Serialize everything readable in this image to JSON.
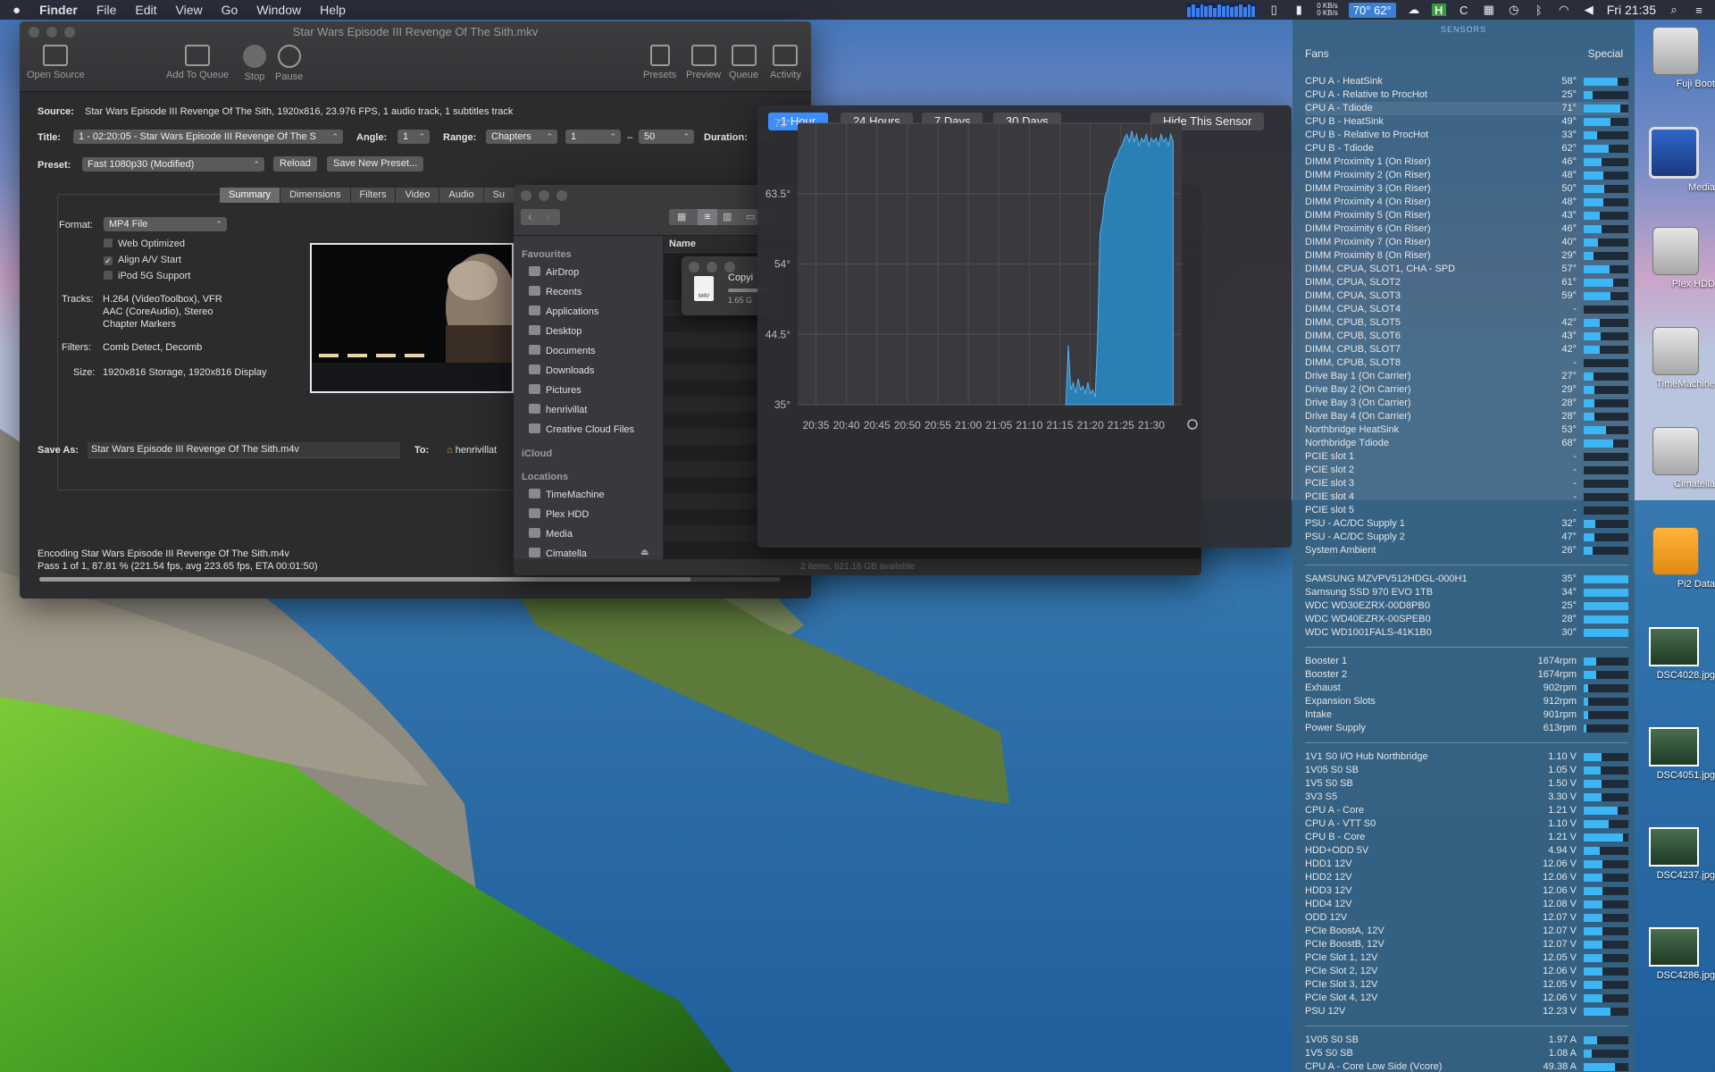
{
  "menubar": {
    "apple": "",
    "items": [
      "Finder",
      "File",
      "Edit",
      "View",
      "Go",
      "Window",
      "Help"
    ],
    "net_up": "0 KB/s",
    "net_down": "0 KB/s",
    "temps": "70° 62°",
    "clock": "Fri 21:35"
  },
  "handbrake": {
    "title": "Star Wars Episode III Revenge Of The Sith.mkv",
    "toolbar": {
      "open_source": "Open Source",
      "add_to_queue": "Add To Queue",
      "stop": "Stop",
      "pause": "Pause",
      "presets": "Presets",
      "preview": "Preview",
      "queue": "Queue",
      "activity": "Activity"
    },
    "source_label": "Source:",
    "source_value": "Star Wars Episode III Revenge Of The Sith, 1920x816, 23.976 FPS, 1 audio track, 1 subtitles track",
    "title_label": "Title:",
    "title_value": "1 - 02:20:05 - Star Wars Episode III Revenge Of The S",
    "angle_label": "Angle:",
    "angle_value": "1",
    "range_label": "Range:",
    "range_type": "Chapters",
    "range_from": "1",
    "range_dash": "–",
    "range_to": "50",
    "duration_label": "Duration:",
    "duration_value": "02",
    "preset_label": "Preset:",
    "preset_value": "Fast 1080p30 (Modified)",
    "reload": "Reload",
    "save_new_preset": "Save New Preset...",
    "tabs": [
      "Summary",
      "Dimensions",
      "Filters",
      "Video",
      "Audio",
      "Su"
    ],
    "format_label": "Format:",
    "format_value": "MP4 File",
    "web_optimized": "Web Optimized",
    "align_av": "Align A/V Start",
    "ipod": "iPod 5G Support",
    "tracks_label": "Tracks:",
    "tracks_lines": [
      "H.264 (VideoToolbox), VFR",
      "AAC (CoreAudio), Stereo",
      "Chapter Markers"
    ],
    "filters_label": "Filters:",
    "filters_value": "Comb Detect, Decomb",
    "size_label": "Size:",
    "size_value": "1920x816 Storage, 1920x816 Display",
    "save_as_label": "Save As:",
    "save_as_value": "Star Wars Episode III Revenge Of The Sith.m4v",
    "to_label": "To:",
    "to_value": "henrivillat",
    "encoding_line": "Encoding Star Wars Episode III Revenge Of The Sith.m4v",
    "pass_line": "Pass 1 of 1, 87.81 % (221.54 fps, avg 223.65 fps, ETA 00:01:50)",
    "progress": 0.8781
  },
  "finder": {
    "favourites_header": "Favourites",
    "favourites": [
      "AirDrop",
      "Recents",
      "Applications",
      "Desktop",
      "Documents",
      "Downloads",
      "Pictures",
      "henrivillat",
      "Creative Cloud Files"
    ],
    "icloud_header": "iCloud",
    "locations_header": "Locations",
    "locations": [
      "TimeMachine",
      "Plex HDD",
      "Media",
      "Cimatella"
    ],
    "column_name": "Name",
    "status": "2 items, 621.16 GB available",
    "copy_title": "Copyi",
    "copy_size": "1.65 G",
    "file_badge": "M4V"
  },
  "history": {
    "tabs": [
      "1 Hour",
      "24 Hours",
      "7 Days",
      "30 Days"
    ],
    "hide": "Hide This Sensor"
  },
  "chart_data": {
    "type": "area",
    "title": "",
    "xlabel": "",
    "ylabel": "",
    "ylim": [
      35,
      73
    ],
    "y_ticks": [
      "73°",
      "63.5°",
      "54°",
      "44.5°",
      "35°"
    ],
    "x_ticks": [
      "20:35",
      "20:40",
      "20:45",
      "20:50",
      "20:55",
      "21:00",
      "21:05",
      "21:10",
      "21:15",
      "21:20",
      "21:25",
      "21:30"
    ],
    "x_range": [
      "20:32",
      "21:35"
    ],
    "points": [
      [
        "21:16.0",
        35
      ],
      [
        "21:16.4",
        43
      ],
      [
        "21:16.8",
        37
      ],
      [
        "21:17.2",
        38
      ],
      [
        "21:17.6",
        36.5
      ],
      [
        "21:18.0",
        38.5
      ],
      [
        "21:18.4",
        37
      ],
      [
        "21:18.8",
        37.5
      ],
      [
        "21:19.2",
        36.5
      ],
      [
        "21:19.6",
        38
      ],
      [
        "21:20.0",
        36.5
      ],
      [
        "21:20.4",
        37
      ],
      [
        "21:20.8",
        36
      ],
      [
        "21:21.2",
        44
      ],
      [
        "21:21.6",
        58
      ],
      [
        "21:22.0",
        60
      ],
      [
        "21:22.4",
        63
      ],
      [
        "21:22.8",
        64
      ],
      [
        "21:23.2",
        66
      ],
      [
        "21:23.6",
        67
      ],
      [
        "21:24.0",
        68
      ],
      [
        "21:24.4",
        68.5
      ],
      [
        "21:24.8",
        69.5
      ],
      [
        "21:25.2",
        70
      ],
      [
        "21:25.6",
        71
      ],
      [
        "21:26.0",
        71.5
      ],
      [
        "21:26.4",
        70.5
      ],
      [
        "21:26.8",
        72
      ],
      [
        "21:27.2",
        70.5
      ],
      [
        "21:27.6",
        71.5
      ],
      [
        "21:28.0",
        70
      ],
      [
        "21:28.4",
        71
      ],
      [
        "21:28.8",
        70.5
      ],
      [
        "21:29.2",
        71.5
      ],
      [
        "21:29.6",
        70
      ],
      [
        "21:30.0",
        71
      ],
      [
        "21:30.4",
        70.5
      ],
      [
        "21:30.8",
        71
      ],
      [
        "21:31.2",
        70
      ],
      [
        "21:31.6",
        71.5
      ],
      [
        "21:32.0",
        70.5
      ],
      [
        "21:32.4",
        71
      ],
      [
        "21:32.8",
        70
      ],
      [
        "21:33.2",
        71.5
      ],
      [
        "21:33.6",
        70.5
      ]
    ],
    "color": "#2a7fb5",
    "grid": true
  },
  "sensors": {
    "header": "SENSORS",
    "fans_label": "Fans",
    "special_label": "Special",
    "temperatures": [
      {
        "name": "CPU A - HeatSink",
        "value": "58°",
        "level": 0.76
      },
      {
        "name": "CPU A - Relative to ProcHot",
        "value": "25°",
        "level": 0.2
      },
      {
        "name": "CPU A - Tdiode",
        "value": "71°",
        "level": 0.82,
        "hl": true
      },
      {
        "name": "CPU B - HeatSink",
        "value": "49°",
        "level": 0.6
      },
      {
        "name": "CPU B - Relative to ProcHot",
        "value": "33°",
        "level": 0.3
      },
      {
        "name": "CPU B - Tdiode",
        "value": "62°",
        "level": 0.55
      },
      {
        "name": "DIMM Proximity 1 (On Riser)",
        "value": "46°",
        "level": 0.4
      },
      {
        "name": "DIMM Proximity 2 (On Riser)",
        "value": "48°",
        "level": 0.44
      },
      {
        "name": "DIMM Proximity 3 (On Riser)",
        "value": "50°",
        "level": 0.46
      },
      {
        "name": "DIMM Proximity 4 (On Riser)",
        "value": "48°",
        "level": 0.44
      },
      {
        "name": "DIMM Proximity 5 (On Riser)",
        "value": "43°",
        "level": 0.36
      },
      {
        "name": "DIMM Proximity 6 (On Riser)",
        "value": "46°",
        "level": 0.4
      },
      {
        "name": "DIMM Proximity 7 (On Riser)",
        "value": "40°",
        "level": 0.32
      },
      {
        "name": "DIMM Proximity 8 (On Riser)",
        "value": "29°",
        "level": 0.22
      },
      {
        "name": "DIMM, CPUA, SLOT1, CHA - SPD",
        "value": "57°",
        "level": 0.58
      },
      {
        "name": "DIMM, CPUA, SLOT2",
        "value": "61°",
        "level": 0.66
      },
      {
        "name": "DIMM, CPUA, SLOT3",
        "value": "59°",
        "level": 0.6
      },
      {
        "name": "DIMM, CPUA, SLOT4",
        "value": "-",
        "level": 0
      },
      {
        "name": "DIMM, CPUB, SLOT5",
        "value": "42°",
        "level": 0.36
      },
      {
        "name": "DIMM, CPUB, SLOT6",
        "value": "43°",
        "level": 0.37
      },
      {
        "name": "DIMM, CPUB, SLOT7",
        "value": "42°",
        "level": 0.36
      },
      {
        "name": "DIMM, CPUB, SLOT8",
        "value": "-",
        "level": 0
      },
      {
        "name": "Drive Bay 1 (On Carrier)",
        "value": "27°",
        "level": 0.22
      },
      {
        "name": "Drive Bay 2 (On Carrier)",
        "value": "29°",
        "level": 0.24
      },
      {
        "name": "Drive Bay 3 (On Carrier)",
        "value": "28°",
        "level": 0.23
      },
      {
        "name": "Drive Bay 4 (On Carrier)",
        "value": "28°",
        "level": 0.23
      },
      {
        "name": "Northbridge HeatSink",
        "value": "53°",
        "level": 0.5
      },
      {
        "name": "Northbridge Tdiode",
        "value": "68°",
        "level": 0.66
      },
      {
        "name": "PCIE slot 1",
        "value": "-",
        "level": 0
      },
      {
        "name": "PCIE slot 2",
        "value": "-",
        "level": 0
      },
      {
        "name": "PCIE slot 3",
        "value": "-",
        "level": 0
      },
      {
        "name": "PCIE slot 4",
        "value": "-",
        "level": 0
      },
      {
        "name": "PCIE slot 5",
        "value": "-",
        "level": 0
      },
      {
        "name": "PSU - AC/DC Supply 1",
        "value": "32°",
        "level": 0.26
      },
      {
        "name": "PSU - AC/DC Supply 2",
        "value": "47°",
        "level": 0.24
      },
      {
        "name": "System Ambient",
        "value": "26°",
        "level": 0.2
      }
    ],
    "drives": [
      {
        "name": "SAMSUNG MZVPV512HDGL-000H1",
        "value": "35°",
        "level": 1
      },
      {
        "name": "Samsung SSD 970 EVO 1TB",
        "value": "34°",
        "level": 1
      },
      {
        "name": "WDC WD30EZRX-00D8PB0",
        "value": "25°",
        "level": 1
      },
      {
        "name": "WDC WD40EZRX-00SPEB0",
        "value": "28°",
        "level": 1
      },
      {
        "name": "WDC WD1001FALS-41K1B0",
        "value": "30°",
        "level": 1
      }
    ],
    "fans": [
      {
        "name": "Booster 1",
        "value": "1674rpm",
        "level": 0.28
      },
      {
        "name": "Booster 2",
        "value": "1674rpm",
        "level": 0.28
      },
      {
        "name": "Exhaust",
        "value": "902rpm",
        "level": 0.1
      },
      {
        "name": "Expansion Slots",
        "value": "912rpm",
        "level": 0.1
      },
      {
        "name": "Intake",
        "value": "901rpm",
        "level": 0.1
      },
      {
        "name": "Power Supply",
        "value": "613rpm",
        "level": 0.06
      }
    ],
    "voltages": [
      {
        "name": "1V1 S0 I/O Hub Northbridge",
        "value": "1.10 V",
        "level": 0.4
      },
      {
        "name": "1V05 S0 SB",
        "value": "1.05 V",
        "level": 0.38
      },
      {
        "name": "1V5 S0 SB",
        "value": "1.50 V",
        "level": 0.4
      },
      {
        "name": "3V3 S5",
        "value": "3.30 V",
        "level": 0.4
      },
      {
        "name": "CPU A - Core",
        "value": "1.21 V",
        "level": 0.75
      },
      {
        "name": "CPU A - VTT S0",
        "value": "1.10 V",
        "level": 0.55
      },
      {
        "name": "CPU B - Core",
        "value": "1.21 V",
        "level": 0.88
      },
      {
        "name": "HDD+ODD 5V",
        "value": "4.94 V",
        "level": 0.35
      },
      {
        "name": "HDD1 12V",
        "value": "12.06 V",
        "level": 0.42
      },
      {
        "name": "HDD2 12V",
        "value": "12.06 V",
        "level": 0.42
      },
      {
        "name": "HDD3 12V",
        "value": "12.06 V",
        "level": 0.42
      },
      {
        "name": "HDD4 12V",
        "value": "12.08 V",
        "level": 0.42
      },
      {
        "name": "ODD 12V",
        "value": "12.07 V",
        "level": 0.42
      },
      {
        "name": "PCIe BoostA, 12V",
        "value": "12.07 V",
        "level": 0.42
      },
      {
        "name": "PCIe BoostB, 12V",
        "value": "12.07 V",
        "level": 0.42
      },
      {
        "name": "PCIe Slot 1, 12V",
        "value": "12.05 V",
        "level": 0.42
      },
      {
        "name": "PCIe Slot 2, 12V",
        "value": "12.06 V",
        "level": 0.42
      },
      {
        "name": "PCIe Slot 3, 12V",
        "value": "12.05 V",
        "level": 0.42
      },
      {
        "name": "PCIe Slot 4, 12V",
        "value": "12.06 V",
        "level": 0.42
      },
      {
        "name": "PSU 12V",
        "value": "12.23 V",
        "level": 0.6
      }
    ],
    "currents": [
      {
        "name": "1V05 S0 SB",
        "value": "1.97 A",
        "level": 0.3
      },
      {
        "name": "1V5 S0 SB",
        "value": "1.08 A",
        "level": 0.18
      },
      {
        "name": "CPU A - Core Low Side (Vcore)",
        "value": "49.38 A",
        "level": 0.7
      }
    ]
  },
  "desktop_icons": [
    {
      "label": "Fuji Boot",
      "kind": "drive"
    },
    {
      "label": "Media",
      "kind": "screen"
    },
    {
      "label": "Plex HDD",
      "kind": "drive"
    },
    {
      "label": "TimeMachine",
      "kind": "drive"
    },
    {
      "label": "Cimatella",
      "kind": "drive"
    },
    {
      "label": "Pi2 Data",
      "kind": "orange"
    },
    {
      "label": "DSC4028.jpg",
      "kind": "photo"
    },
    {
      "label": "DSC4051.jpg",
      "kind": "photo"
    },
    {
      "label": "DSC4237.jpg",
      "kind": "photo"
    },
    {
      "label": "DSC4286.jpg",
      "kind": "photo"
    }
  ]
}
